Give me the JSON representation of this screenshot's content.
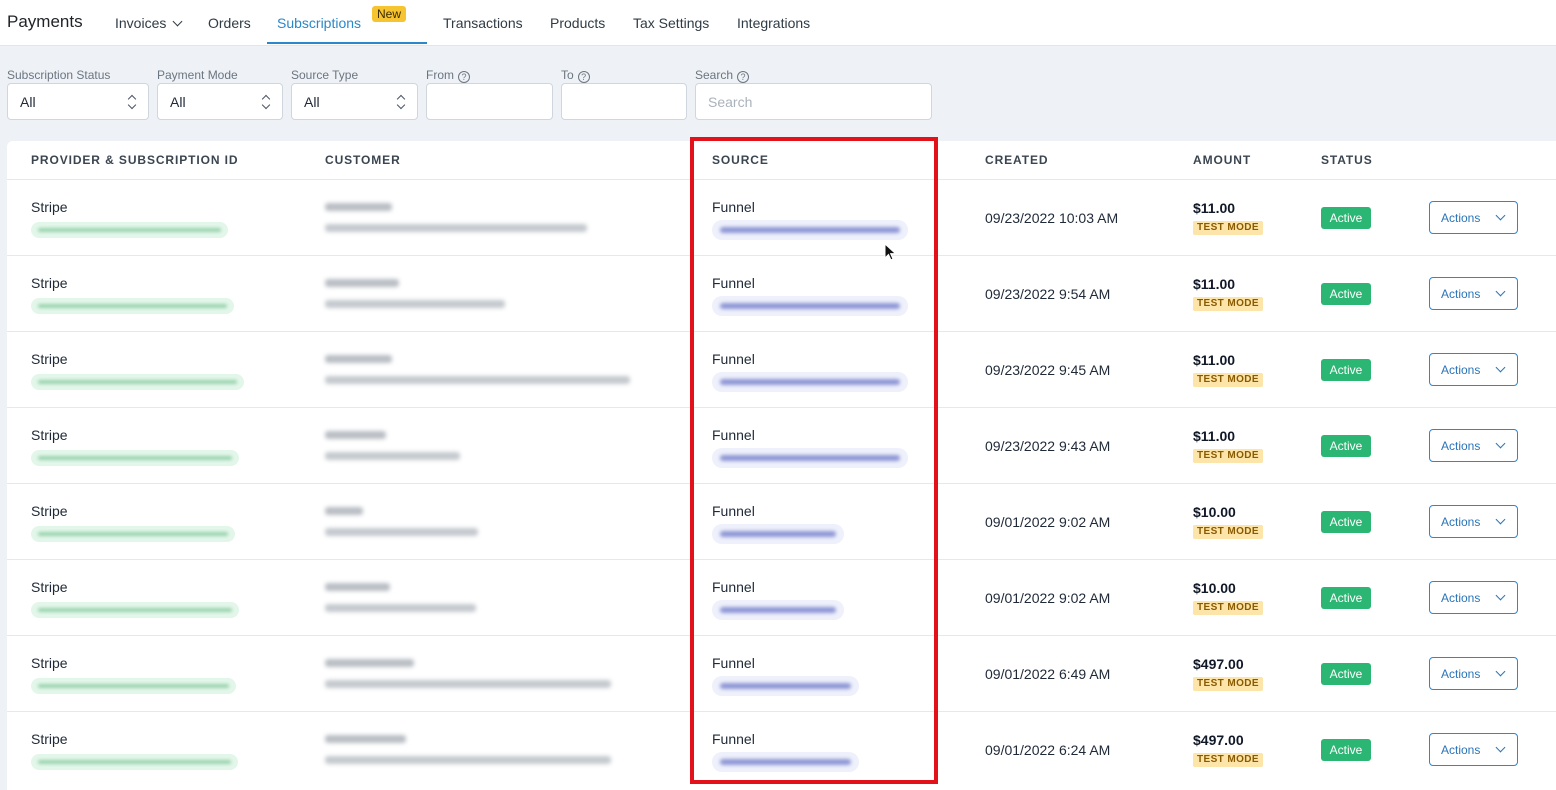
{
  "nav": {
    "brand": "Payments",
    "items": [
      {
        "label": "Invoices"
      },
      {
        "label": "Orders"
      },
      {
        "label": "Subscriptions"
      },
      {
        "label": "Transactions"
      },
      {
        "label": "Products"
      },
      {
        "label": "Tax Settings"
      },
      {
        "label": "Integrations"
      }
    ],
    "active_item": "Subscriptions",
    "new_badge": "New"
  },
  "filters": {
    "subscription_status": {
      "label": "Subscription Status",
      "value": "All"
    },
    "payment_mode": {
      "label": "Payment Mode",
      "value": "All"
    },
    "source_type": {
      "label": "Source Type",
      "value": "All"
    },
    "from": {
      "label": "From",
      "value": ""
    },
    "to": {
      "label": "To",
      "value": ""
    },
    "search": {
      "label": "Search",
      "placeholder": "Search",
      "value": ""
    }
  },
  "table": {
    "columns": [
      "PROVIDER & SUBSCRIPTION ID",
      "CUSTOMER",
      "SOURCE",
      "CREATED",
      "AMOUNT",
      "STATUS"
    ],
    "rows": [
      {
        "provider": "Stripe",
        "source": "Funnel",
        "created": "09/23/2022 10:03 AM",
        "amount": "$11.00",
        "mode": "TEST MODE",
        "status": "Active",
        "action": "Actions"
      },
      {
        "provider": "Stripe",
        "source": "Funnel",
        "created": "09/23/2022 9:54 AM",
        "amount": "$11.00",
        "mode": "TEST MODE",
        "status": "Active",
        "action": "Actions"
      },
      {
        "provider": "Stripe",
        "source": "Funnel",
        "created": "09/23/2022 9:45 AM",
        "amount": "$11.00",
        "mode": "TEST MODE",
        "status": "Active",
        "action": "Actions"
      },
      {
        "provider": "Stripe",
        "source": "Funnel",
        "created": "09/23/2022 9:43 AM",
        "amount": "$11.00",
        "mode": "TEST MODE",
        "status": "Active",
        "action": "Actions"
      },
      {
        "provider": "Stripe",
        "source": "Funnel",
        "created": "09/01/2022 9:02 AM",
        "amount": "$10.00",
        "mode": "TEST MODE",
        "status": "Active",
        "action": "Actions"
      },
      {
        "provider": "Stripe",
        "source": "Funnel",
        "created": "09/01/2022 9:02 AM",
        "amount": "$10.00",
        "mode": "TEST MODE",
        "status": "Active",
        "action": "Actions"
      },
      {
        "provider": "Stripe",
        "source": "Funnel",
        "created": "09/01/2022 6:49 AM",
        "amount": "$497.00",
        "mode": "TEST MODE",
        "status": "Active",
        "action": "Actions"
      },
      {
        "provider": "Stripe",
        "source": "Funnel",
        "created": "09/01/2022 6:24 AM",
        "amount": "$497.00",
        "mode": "TEST MODE",
        "status": "Active",
        "action": "Actions"
      }
    ]
  },
  "colors": {
    "accent": "#2b87c9",
    "status_active": "#2bb673",
    "highlight_box": "#e3111a",
    "test_mode_bg": "#fde4a8"
  }
}
